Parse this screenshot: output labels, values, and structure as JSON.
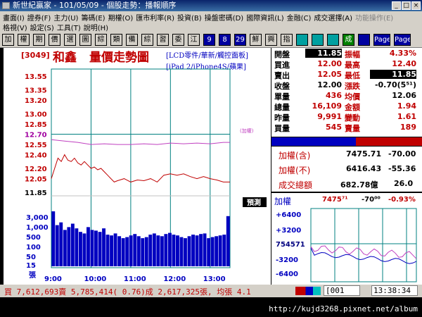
{
  "window": {
    "title": "新世紀贏家 - 101/05/09 - 個股走勢：播報順序"
  },
  "menu": {
    "row1": [
      "畫面(I)",
      "證券(F)",
      "主力(U)",
      "籌碼(E)",
      "期權(O)",
      "匯市利率(R)",
      "投資(B)",
      "操盤密碼(D)",
      "國際資訊(L)",
      "金融(C)",
      "成交選擇(A)",
      "功能操作(E)"
    ],
    "row2": [
      "格視(V)",
      "設定(S)",
      "工具(T)",
      "說明(H)"
    ]
  },
  "toolbar": [
    "加",
    "權",
    "期",
    "價",
    "選",
    "圖",
    "綜",
    "類",
    "備",
    "綜",
    "習",
    "委",
    "江",
    "9",
    "8",
    "29",
    "鮮",
    "興",
    "指",
    "",
    "",
    "",
    "成",
    "",
    "Page",
    "Page"
  ],
  "stock": {
    "code": "[3049]",
    "name": "和鑫",
    "chart_title": "量價走勢圖",
    "category1": "[LCD零件/華新/觸控面板]",
    "category2": "[iPad 2/iPhone4S/蘋果]"
  },
  "quote": {
    "rows": [
      {
        "l1": "開盤",
        "v1": "11.85",
        "l2": "振幅",
        "v2": "4.33%",
        "c1": "#ffffff",
        "bg1": "#000000",
        "c2": "#c00000"
      },
      {
        "l1": "買進",
        "v1": "12.00",
        "l2": "最高",
        "v2": "12.40",
        "c1": "#c00000",
        "c2": "#c00000"
      },
      {
        "l1": "賣出",
        "v1": "12.05",
        "l2": "最低",
        "v2": "11.85",
        "c1": "#c00000",
        "c2": "#ffffff",
        "bg2": "#000000"
      },
      {
        "l1": "收盤",
        "v1": "12.00",
        "l2": "漲跌",
        "v2": "-0.70(5⁵¹)",
        "c1": "#000000",
        "c2": "#000000"
      },
      {
        "l1": "單量",
        "v1": "436",
        "l2": "均價",
        "v2": "12.06",
        "c1": "#c00000",
        "c2": "#000000"
      },
      {
        "l1": "總量",
        "v1": "16,109",
        "l2": "金額",
        "v2": "1.94",
        "c1": "#c00000",
        "c2": "#c00000"
      },
      {
        "l1": "昨量",
        "v1": "9,991",
        "l2": "變動",
        "v2": "1.61",
        "c1": "#c00000",
        "c2": "#c00000"
      },
      {
        "l1": "買量",
        "v1": "545",
        "l2": "賣量",
        "v2": "189",
        "c1": "#c00000",
        "c2": "#c00000"
      }
    ]
  },
  "index": {
    "rows": [
      {
        "label": "加權(含)",
        "value": "7475.71",
        "change": "-70.00"
      },
      {
        "label": "加權(不)",
        "value": "6416.43",
        "change": "-55.36"
      },
      {
        "label": "成交總額",
        "value": "682.78億",
        "change": "26.0"
      }
    ],
    "mini_label": "加權",
    "mini_value": "7475⁷¹",
    "mini_change": "-70⁰⁰",
    "mini_pct": "-0.93%",
    "mini_ticks": [
      "+6400",
      "+3200",
      "754571",
      "-3200",
      "-6400"
    ]
  },
  "prediction_badge": "預測",
  "reference_label": "(加權)",
  "volume_unit": "張",
  "statusbar": {
    "text": "買 7,612,693賣 5,785,414( 0.76)成 2,617,325張, 均張 4.1",
    "field": "[001",
    "time": "13:38:34"
  },
  "watermark": "http://kujd3268.pixnet.net/album",
  "chart_data": {
    "type": "line",
    "x_ticks": [
      "9:00",
      "10:00",
      "11:00",
      "12:00",
      "13:00"
    ],
    "price_ticks": [
      "13.55",
      "13.35",
      "13.20",
      "13.00",
      "12.85",
      "12.70",
      "12.55",
      "12.40",
      "12.20",
      "12.05",
      "11.85"
    ],
    "price_ylim": [
      11.85,
      13.55
    ],
    "reference_price": 12.7,
    "volume_ticks": [
      "3,000",
      "1,000",
      "500",
      "100",
      "50",
      "15",
      "張"
    ],
    "series": [
      {
        "name": "price",
        "color": "#c00000",
        "x": [
          0,
          5,
          10,
          15,
          20,
          25,
          30,
          35,
          40,
          45,
          50,
          55,
          60,
          65,
          70,
          75,
          80,
          85,
          90,
          95,
          100,
          110,
          120,
          130,
          140,
          150,
          160,
          170,
          180,
          190,
          200,
          210,
          220,
          230,
          240,
          250,
          260,
          270
        ],
        "y": [
          12.05,
          12.2,
          12.35,
          12.3,
          12.4,
          12.32,
          12.3,
          12.35,
          12.28,
          12.25,
          12.3,
          12.25,
          12.2,
          12.22,
          12.18,
          12.2,
          12.15,
          12.1,
          12.05,
          12.0,
          12.02,
          12.05,
          12.0,
          12.03,
          12.02,
          12.05,
          12.0,
          12.1,
          12.12,
          12.1,
          12.12,
          12.08,
          12.05,
          12.08,
          12.05,
          12.03,
          12.0,
          12.0
        ]
      },
      {
        "name": "index",
        "color": "#c040c0",
        "x": [
          0,
          20,
          40,
          60,
          80,
          100,
          120,
          140,
          160,
          180,
          200,
          220,
          240,
          260,
          270
        ],
        "y": [
          12.62,
          12.6,
          12.58,
          12.55,
          12.56,
          12.55,
          12.55,
          12.56,
          12.55,
          12.57,
          12.56,
          12.57,
          12.56,
          12.58,
          12.58
        ]
      }
    ],
    "volume": [
      3000,
      400,
      600,
      200,
      300,
      500,
      250,
      150,
      120,
      300,
      200,
      180,
      150,
      250,
      100,
      90,
      120,
      80,
      60,
      70,
      90,
      110,
      80,
      60,
      70,
      100,
      120,
      90,
      80,
      110,
      130,
      100,
      90,
      70,
      60,
      80,
      100,
      90,
      110,
      120,
      60,
      70,
      80,
      90,
      100,
      1500
    ]
  }
}
